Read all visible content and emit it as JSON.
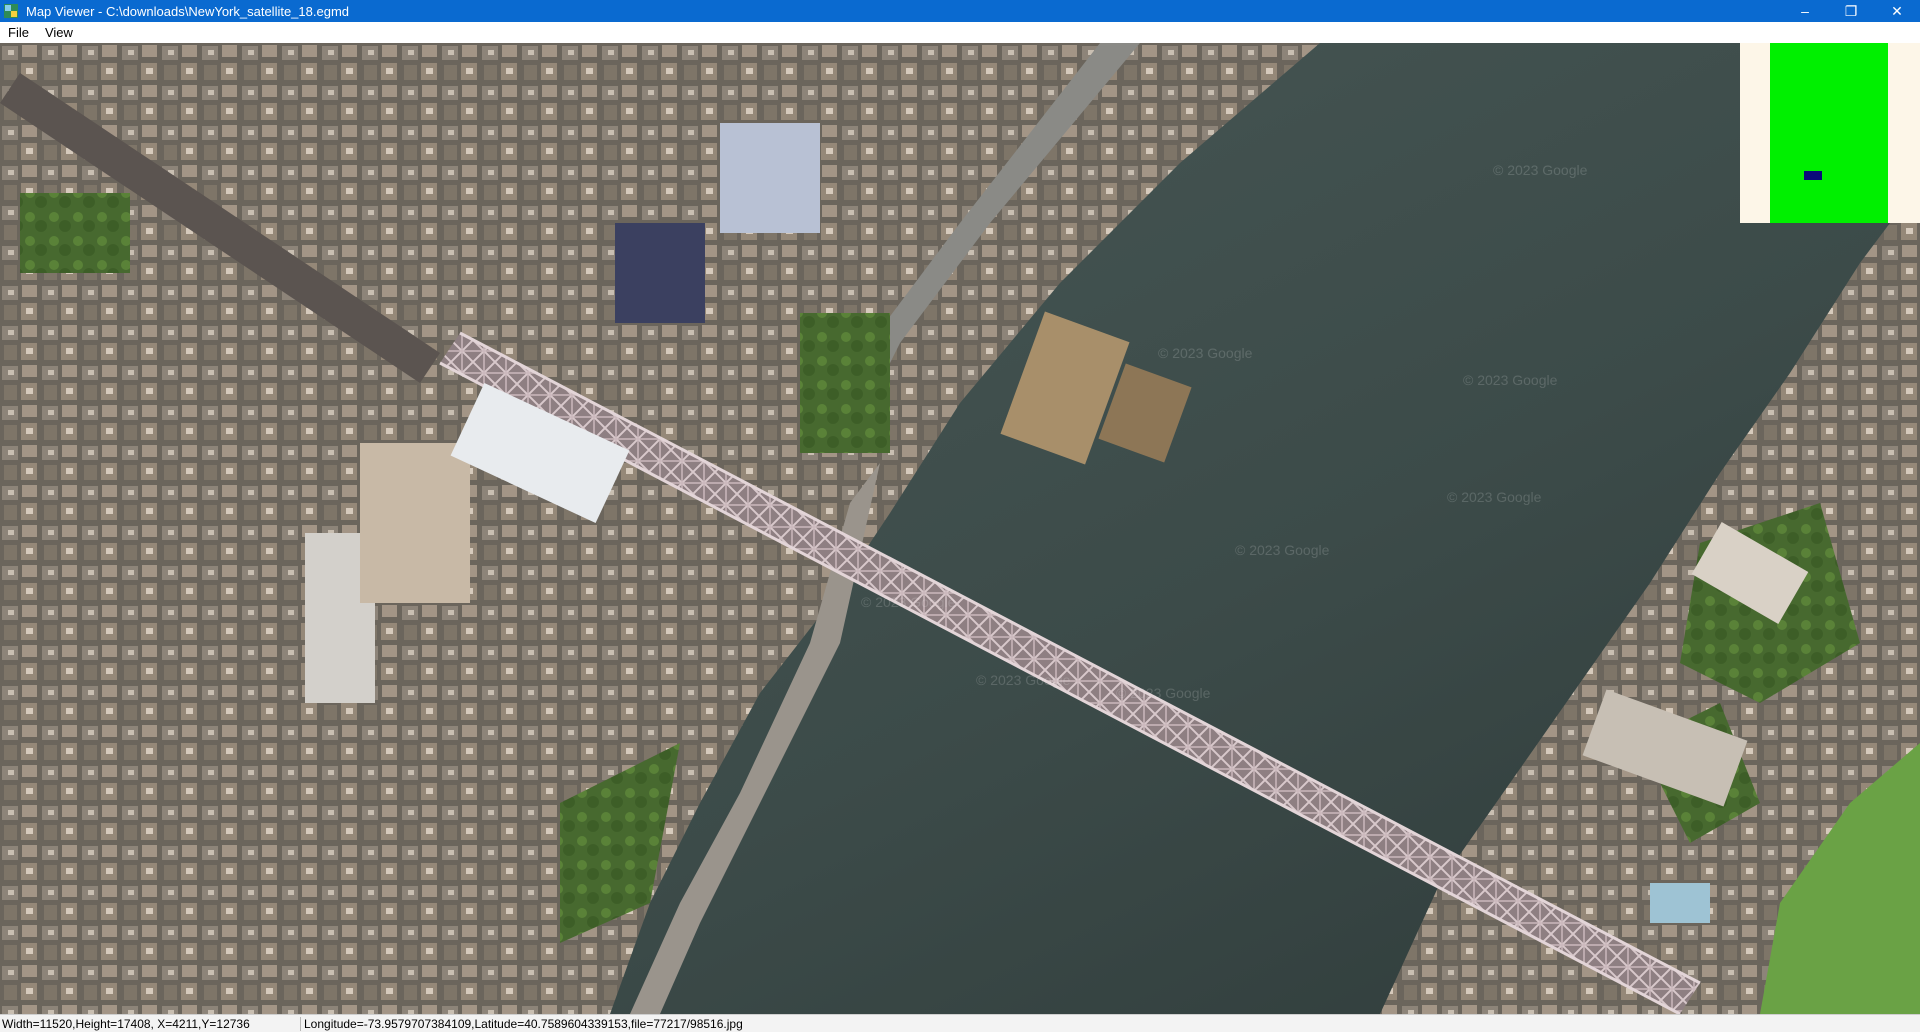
{
  "window": {
    "title": "Map Viewer - C:\\downloads\\NewYork_satellite_18.egmd",
    "app_icon": "map-app-icon",
    "controls": {
      "minimize": "–",
      "maximize": "❐",
      "close": "✕"
    }
  },
  "menu": {
    "items": [
      {
        "label": "File"
      },
      {
        "label": "View"
      }
    ]
  },
  "map": {
    "watermark": "© 2023 Google",
    "colors": {
      "water": "#3f4f4e",
      "city": "#6b655c",
      "park": "#4f7a3a",
      "bridge": "#b7a5a8"
    }
  },
  "overview": {
    "background": "#fdf6e8",
    "coverage_color": "#00f000",
    "viewport_color": "#0a0a7a"
  },
  "status": {
    "size_position": "Width=11520,Height=17408, X=4211,Y=12736",
    "geo": "Longitude=-73.9579707384109,Latitude=40.7589604339153,file=77217/98516.jpg"
  }
}
